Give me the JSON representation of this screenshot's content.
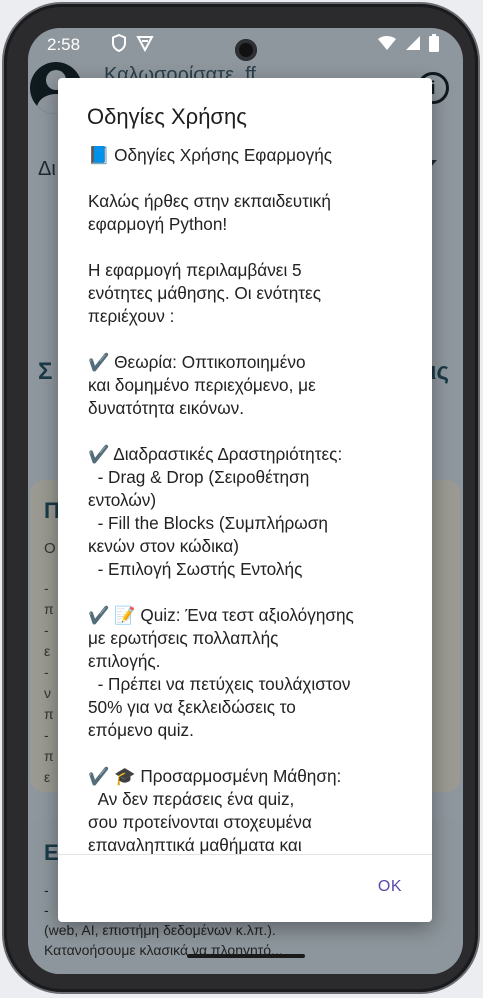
{
  "status_bar": {
    "time": "2:58",
    "left_icons": [
      "shield-icon",
      "vpn-icon"
    ],
    "right_icons": [
      "wifi-icon",
      "cell-signal-icon",
      "battery-icon"
    ]
  },
  "background_app": {
    "welcome_text": "Καλωσορίσατε, ff",
    "dropdown_visible_text": "Δι",
    "section_left_stub": "Σ",
    "section_right_stub": "ις",
    "card1": {
      "title_stub": "Π",
      "subtitle_stub": "Ο",
      "lines": [
        "-",
        "π",
        "-",
        "ε",
        "-",
        "ν",
        "π",
        "-",
        "π",
        "ε"
      ]
    },
    "card2": {
      "title_stub": "Ε",
      "lines": [
        "-",
        "-",
        "(web, AI, επιστήμη δεδομένων κ.λπ.).",
        "Κατανοήσουμε κλασικά να πλοηγητό..."
      ]
    }
  },
  "dialog": {
    "title": "Οδηγίες Χρήσης",
    "paragraphs": [
      "📘 Οδηγίες Χρήσης Εφαρμογής",
      "",
      "Καλώς ήρθες στην εκπαιδευτική\nεφαρμογή Python!",
      "",
      "Η εφαρμογή περιλαμβάνει 5\nενότητες μάθησης. Οι ενότητες\nπεριέχουν :",
      "",
      "✔️ Θεωρία: Οπτικοποιημένο\nκαι δομημένο περιεχόμενο, με\nδυνατότητα εικόνων.",
      "",
      "✔️ Διαδραστικές Δραστηριότητες:\n  - Drag & Drop (Σειροθέτηση\nεντολών)\n  - Fill the Blocks (Συμπλήρωση\nκενών στον κώδικα)\n  - Επιλογή Σωστής Εντολής",
      "",
      "✔️ 📝 Quiz: Ένα τεστ αξιολόγησης\nμε ερωτήσεις πολλαπλής\nεπιλογής.\n  - Πρέπει να πετύχεις τουλάχιστον\n50% για να ξεκλειδώσεις το\nεπόμενο quiz.",
      "",
      "✔️ 🎓 Προσαρμοσμένη Μάθηση:\n  Αν δεν περάσεις ένα quiz,\nσου προτείνονται στοχευμένα\nεπαναληπτικά μαθήματα και"
    ],
    "ok_label": "OK"
  },
  "colors": {
    "dialog_accent": "#5b4aa8",
    "scrim_background": "#8f979e"
  }
}
